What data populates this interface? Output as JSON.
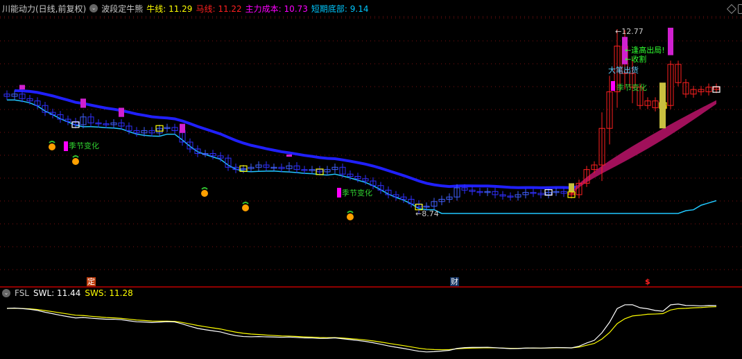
{
  "header": {
    "title": "川能动力(日线,前复权)",
    "indicator_name": "波段定牛熊",
    "bull_line": {
      "label": "牛线:",
      "value": "11.29",
      "color": "#ffff00"
    },
    "horse_line": {
      "label": "马线:",
      "value": "11.22",
      "color": "#ff2020"
    },
    "main_cost": {
      "label": "主力成本:",
      "value": "10.73",
      "color": "#ff00ff"
    },
    "short_bottom": {
      "label": "短期底部:",
      "value": "9.14",
      "color": "#00c8ff"
    }
  },
  "sub_panel": {
    "name": "FSL",
    "swl": {
      "label": "SWL:",
      "value": "11.44",
      "color": "#ffffff"
    },
    "sws": {
      "label": "SWS:",
      "value": "11.28",
      "color": "#ffff00"
    }
  },
  "annotations": {
    "high_label": "12.77",
    "low_label": "8.74",
    "season_change": "季节变化",
    "sell_high": "逢高出局!",
    "harvest": "收割",
    "big_selling": "大笔出货"
  },
  "markers": {
    "ding": "定",
    "cai": "财",
    "dollar": "$"
  },
  "chart_data": {
    "type": "candlestick",
    "price_range": [
      7.2,
      13.2
    ],
    "high": 12.77,
    "low": 8.74,
    "closes": [
      11.3,
      11.35,
      11.25,
      11.2,
      11.1,
      10.95,
      10.9,
      10.8,
      10.75,
      10.68,
      10.85,
      10.72,
      10.7,
      10.68,
      10.72,
      10.65,
      10.55,
      10.5,
      10.55,
      10.5,
      10.6,
      10.62,
      10.55,
      10.3,
      10.15,
      10.05,
      10.05,
      10.0,
      9.95,
      9.75,
      9.7,
      9.72,
      9.75,
      9.8,
      9.75,
      9.75,
      9.72,
      9.78,
      9.7,
      9.68,
      9.7,
      9.65,
      9.7,
      9.75,
      9.6,
      9.55,
      9.5,
      9.45,
      9.35,
      9.25,
      9.15,
      9.1,
      9.05,
      8.95,
      8.88,
      8.9,
      9.0,
      9.05,
      9.1,
      9.3,
      9.25,
      9.22,
      9.2,
      9.22,
      9.15,
      9.12,
      9.1,
      9.15,
      9.2,
      9.18,
      9.15,
      9.2,
      9.22,
      9.18,
      9.15,
      9.4,
      9.7,
      9.8,
      10.6,
      11.4,
      12.4,
      11.8,
      11.5,
      11.1,
      11.2,
      11.05,
      11.1,
      12.0,
      11.6,
      11.35,
      11.45,
      11.4,
      11.5,
      11.45
    ]
  }
}
